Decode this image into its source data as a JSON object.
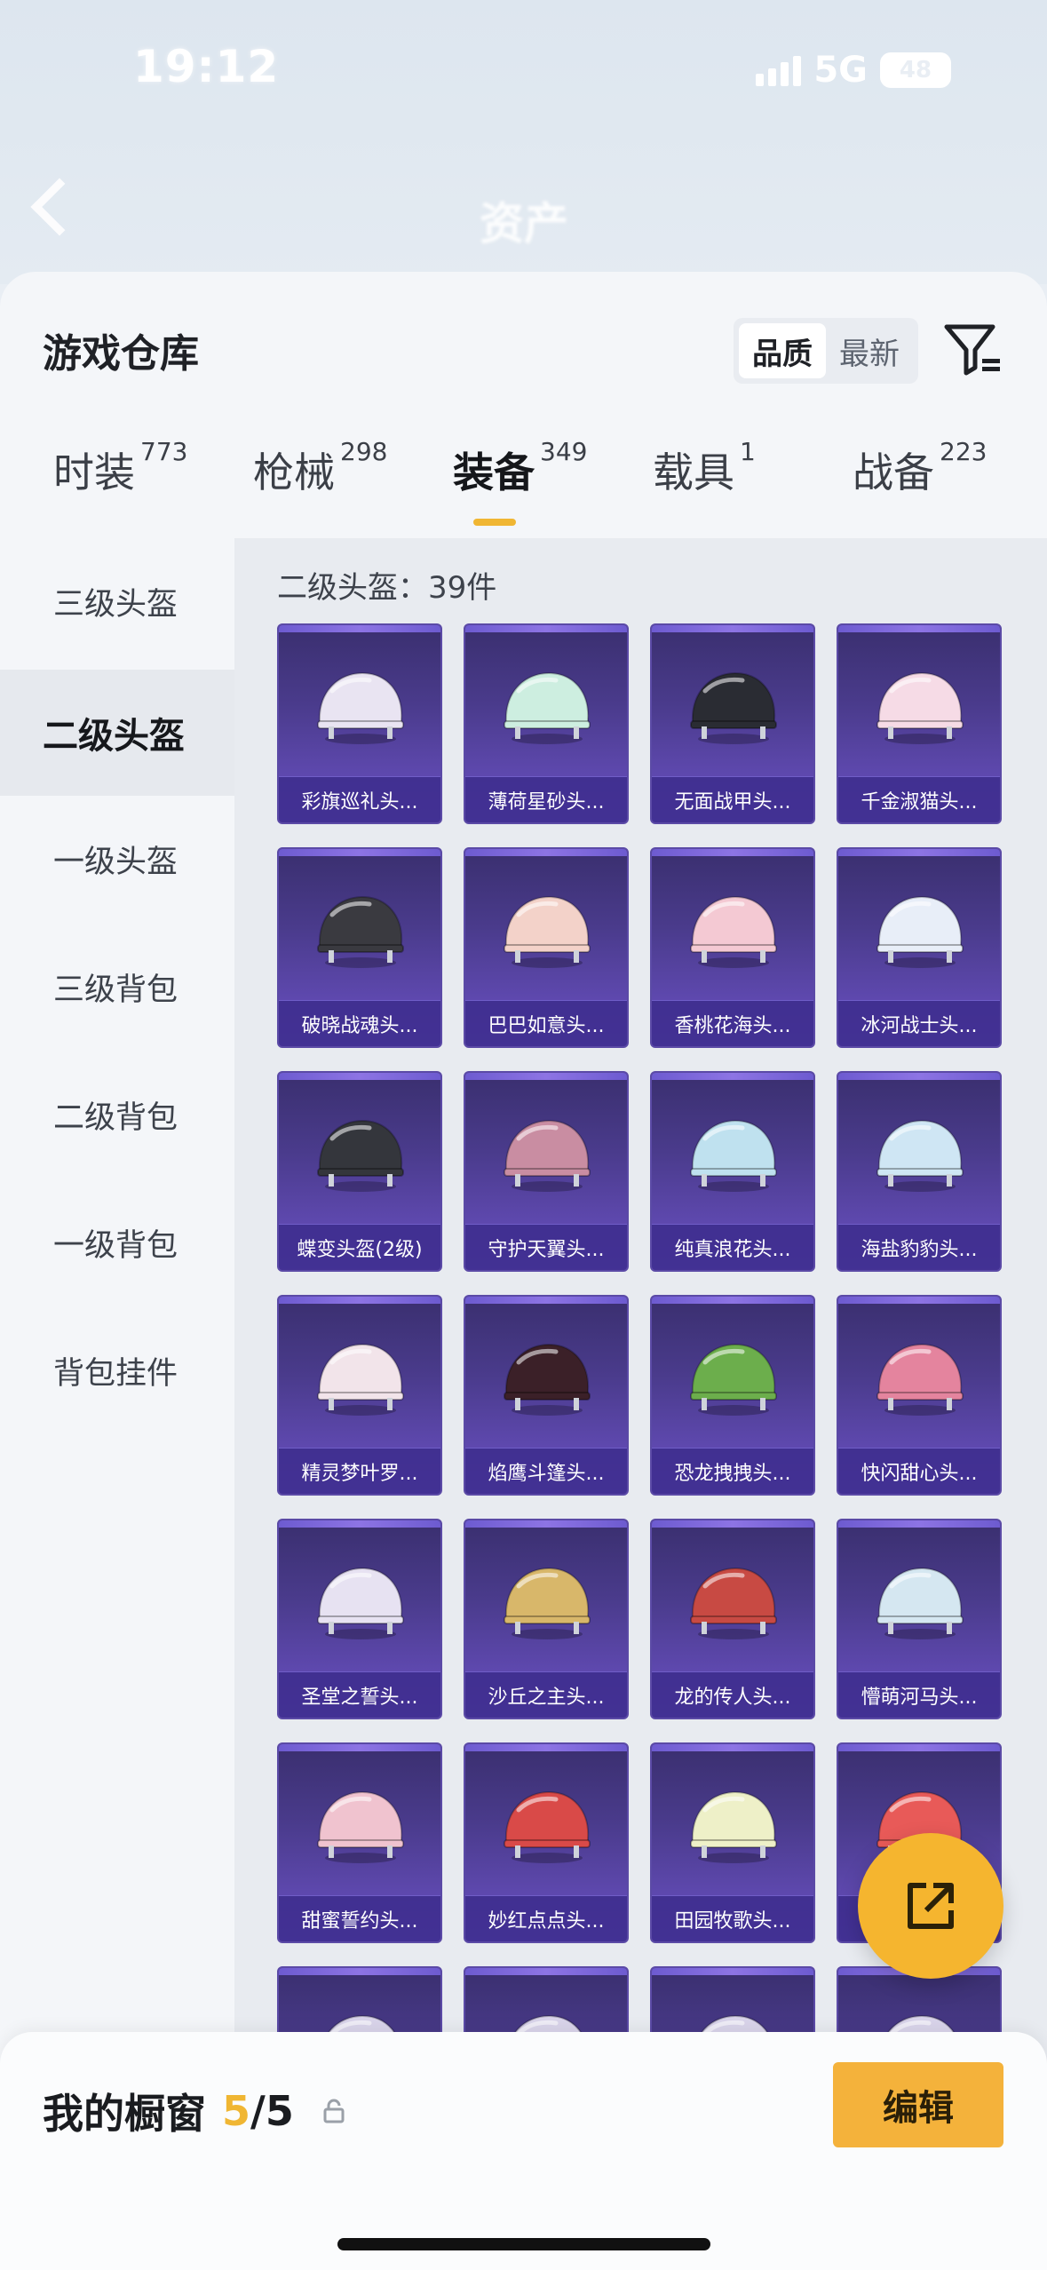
{
  "status_bar": {
    "time": "19:12",
    "network": "5G",
    "battery": "48"
  },
  "background": {
    "title": "资产"
  },
  "sheet": {
    "title": "游戏仓库",
    "sort": {
      "options": [
        "品质",
        "最新"
      ],
      "selected": "品质"
    }
  },
  "tabs": [
    {
      "label": "时装",
      "count": "773"
    },
    {
      "label": "枪械",
      "count": "298"
    },
    {
      "label": "装备",
      "count": "349",
      "active": true
    },
    {
      "label": "载具",
      "count": "1"
    },
    {
      "label": "战备",
      "count": "223"
    }
  ],
  "sidebar": [
    {
      "label": "三级头盔"
    },
    {
      "label": "二级头盔",
      "active": true
    },
    {
      "label": "一级头盔"
    },
    {
      "label": "三级背包"
    },
    {
      "label": "二级背包"
    },
    {
      "label": "一级背包"
    },
    {
      "label": "背包挂件"
    }
  ],
  "content": {
    "count_label": "二级头盔：39件",
    "items": [
      {
        "name": "彩旗巡礼头...",
        "color": "#e9e4f2"
      },
      {
        "name": "薄荷星砂头...",
        "color": "#cdeee0"
      },
      {
        "name": "无面战甲头...",
        "color": "#2a2c33"
      },
      {
        "name": "千金淑猫头...",
        "color": "#f6dbe6"
      },
      {
        "name": "破晓战魂头...",
        "color": "#3a3a40"
      },
      {
        "name": "巴巴如意头...",
        "color": "#f3d2c9"
      },
      {
        "name": "香桃花海头...",
        "color": "#f4c9d3"
      },
      {
        "name": "冰河战士头...",
        "color": "#e8eef8"
      },
      {
        "name": "蝶变头盔(2级)",
        "color": "#34363c"
      },
      {
        "name": "守护天翼头...",
        "color": "#c98da2"
      },
      {
        "name": "纯真浪花头...",
        "color": "#bfe1ef"
      },
      {
        "name": "海盐豹豹头...",
        "color": "#cfe6f4"
      },
      {
        "name": "精灵梦叶罗...",
        "color": "#f2e4ea"
      },
      {
        "name": "焰鹰斗篷头...",
        "color": "#3b2028"
      },
      {
        "name": "恐龙拽拽头...",
        "color": "#6cae4c"
      },
      {
        "name": "快闪甜心头...",
        "color": "#e4849e"
      },
      {
        "name": "圣堂之誓头...",
        "color": "#e7e2f2"
      },
      {
        "name": "沙丘之主头...",
        "color": "#d8b76a"
      },
      {
        "name": "龙的传人头...",
        "color": "#c84a43"
      },
      {
        "name": "懵萌河马头...",
        "color": "#d5e7f1"
      },
      {
        "name": "甜蜜誓约头...",
        "color": "#f0c3cf"
      },
      {
        "name": "妙红点点头...",
        "color": "#d94a48"
      },
      {
        "name": "田园牧歌头...",
        "color": "#eef0c8"
      },
      {
        "name": "",
        "color": "#e85a58"
      }
    ]
  },
  "bottom": {
    "showcase_label": "我的橱窗",
    "showcase_used": "5",
    "showcase_total": "/5",
    "edit_label": "编辑"
  },
  "colors": {
    "accent": "#f0b633",
    "card_bg": "#4a3b8c",
    "fab": "#f5b52f"
  }
}
